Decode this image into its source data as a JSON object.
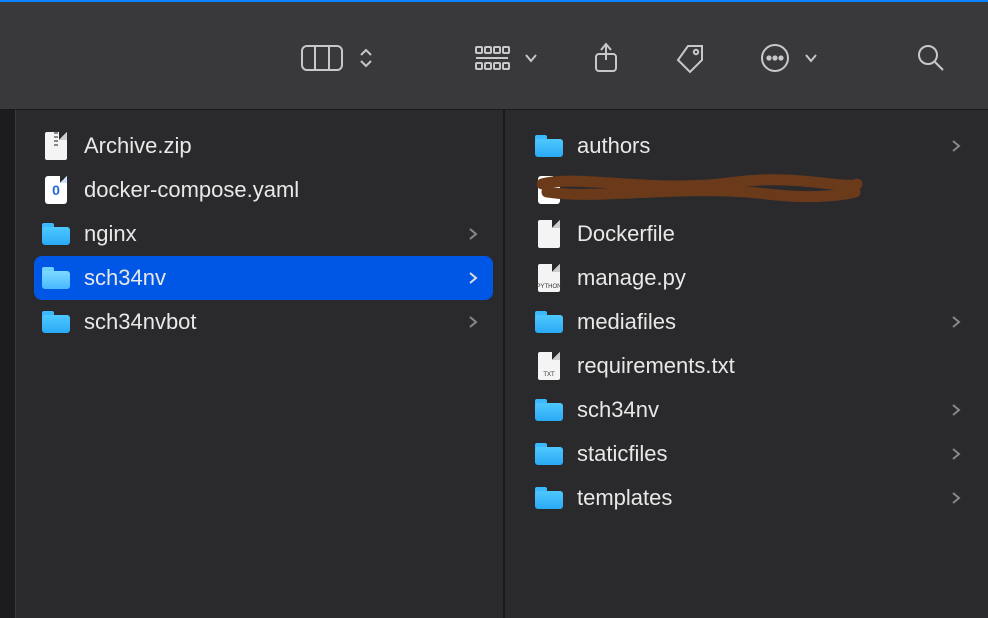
{
  "icons": {
    "zip": "zip",
    "yaml": "0",
    "python": "PYTHON",
    "text": "TXT",
    "blank": ""
  },
  "columns": [
    {
      "items": [
        {
          "name": "Archive.zip",
          "kind": "zip",
          "nav": false,
          "selected": false
        },
        {
          "name": "docker-compose.yaml",
          "kind": "yaml",
          "nav": false,
          "selected": false
        },
        {
          "name": "nginx",
          "kind": "folder",
          "nav": true,
          "selected": false
        },
        {
          "name": "sch34nv",
          "kind": "folder",
          "nav": true,
          "selected": true
        },
        {
          "name": "sch34nvbot",
          "kind": "folder",
          "nav": true,
          "selected": false
        }
      ]
    },
    {
      "items": [
        {
          "name": "authors",
          "kind": "folder",
          "nav": true,
          "selected": false
        },
        {
          "name": "",
          "kind": "yaml",
          "nav": false,
          "selected": false,
          "redacted": true
        },
        {
          "name": "Dockerfile",
          "kind": "blank",
          "nav": false,
          "selected": false
        },
        {
          "name": "manage.py",
          "kind": "python",
          "nav": false,
          "selected": false
        },
        {
          "name": "mediafiles",
          "kind": "folder",
          "nav": true,
          "selected": false
        },
        {
          "name": "requirements.txt",
          "kind": "text",
          "nav": false,
          "selected": false
        },
        {
          "name": "sch34nv",
          "kind": "folder",
          "nav": true,
          "selected": false
        },
        {
          "name": "staticfiles",
          "kind": "folder",
          "nav": true,
          "selected": false
        },
        {
          "name": "templates",
          "kind": "folder",
          "nav": true,
          "selected": false
        }
      ]
    }
  ]
}
